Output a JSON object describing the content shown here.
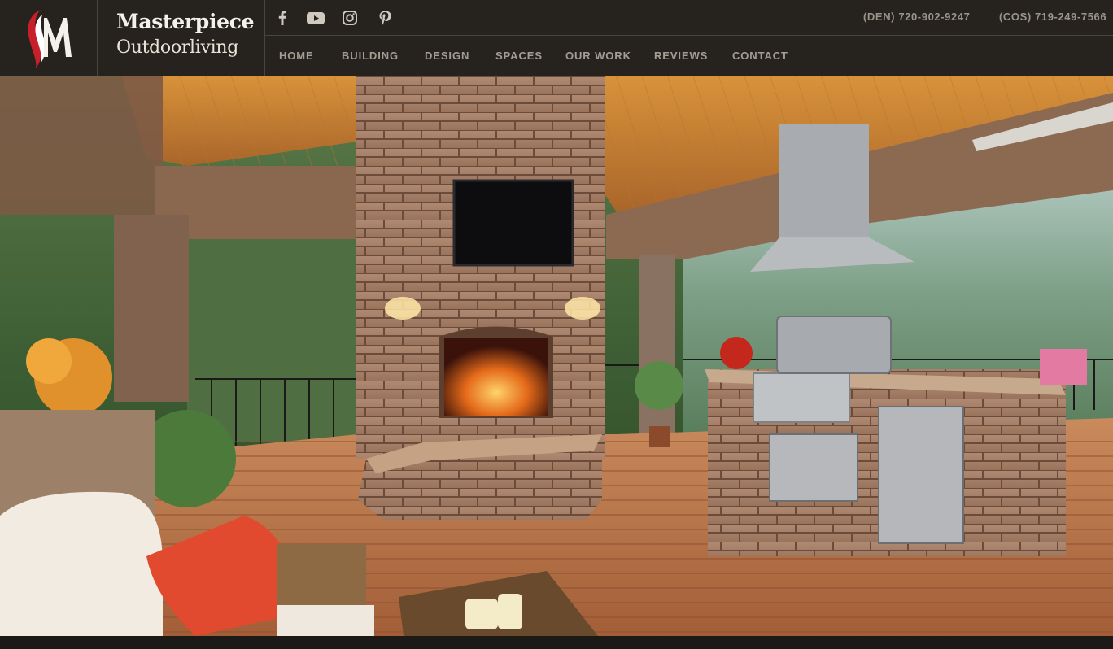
{
  "brand": {
    "name_line1": "Masterpiece",
    "name_line2": "Outdoorliving",
    "logo_icon": "sm-monogram-logo"
  },
  "social": [
    {
      "name": "facebook",
      "icon": "facebook-icon"
    },
    {
      "name": "youtube",
      "icon": "youtube-icon"
    },
    {
      "name": "instagram",
      "icon": "instagram-icon"
    },
    {
      "name": "pinterest",
      "icon": "pinterest-icon"
    }
  ],
  "phones": {
    "den": "(DEN) 720-902-9247",
    "cos": "(COS) 719-249-7566"
  },
  "nav": {
    "items": [
      {
        "label": "HOME"
      },
      {
        "label": "BUILDING"
      },
      {
        "label": "DESIGN"
      },
      {
        "label": "SPACES"
      },
      {
        "label": "OUR WORK"
      },
      {
        "label": "REVIEWS"
      },
      {
        "label": "CONTACT"
      }
    ]
  },
  "hero": {
    "image_subject": "covered-outdoor-living-deck-photo"
  },
  "colors": {
    "header_bg": "#26221e",
    "nav_text": "#a39d93",
    "phone_text": "#9a948b",
    "brand_text": "#f4f0ea",
    "logo_red": "#c8202a"
  }
}
